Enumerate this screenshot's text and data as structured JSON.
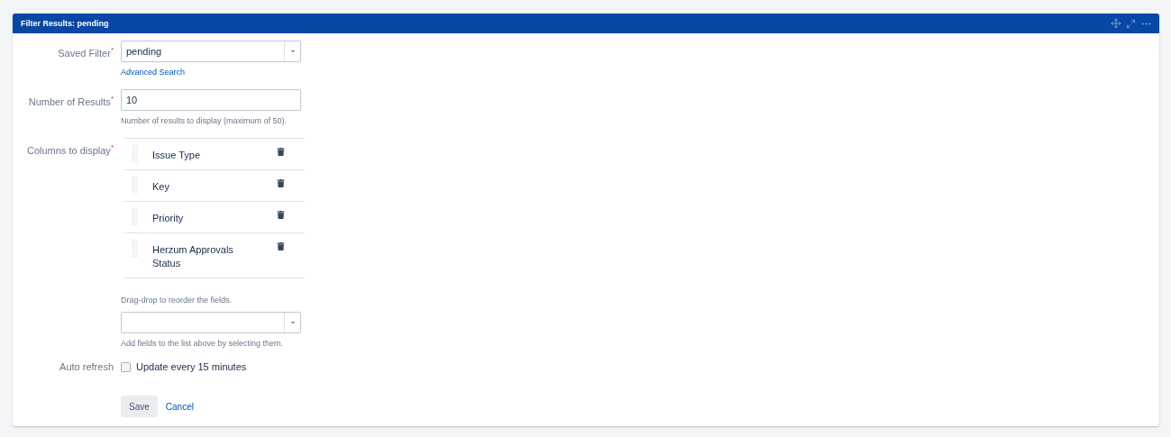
{
  "panel": {
    "title": "Filter Results: pending"
  },
  "saved_filter": {
    "label": "Saved Filter",
    "required_mark": "*",
    "value": "pending",
    "link": "Advanced Search"
  },
  "number_of_results": {
    "label": "Number of Results",
    "required_mark": "*",
    "value": "10",
    "help": "Number of results to display (maximum of 50)."
  },
  "columns": {
    "label": "Columns to display",
    "required_mark": "*",
    "items": [
      {
        "name": "Issue Type"
      },
      {
        "name": "Key"
      },
      {
        "name": "Priority"
      },
      {
        "name": "Herzum Approvals Status"
      }
    ],
    "hint": "Drag-drop to reorder the fields.",
    "add_help": "Add fields to the list above by selecting them."
  },
  "auto_refresh": {
    "label": "Auto refresh",
    "option": "Update every 15 minutes",
    "checked": false
  },
  "buttons": {
    "save": "Save",
    "cancel": "Cancel"
  }
}
